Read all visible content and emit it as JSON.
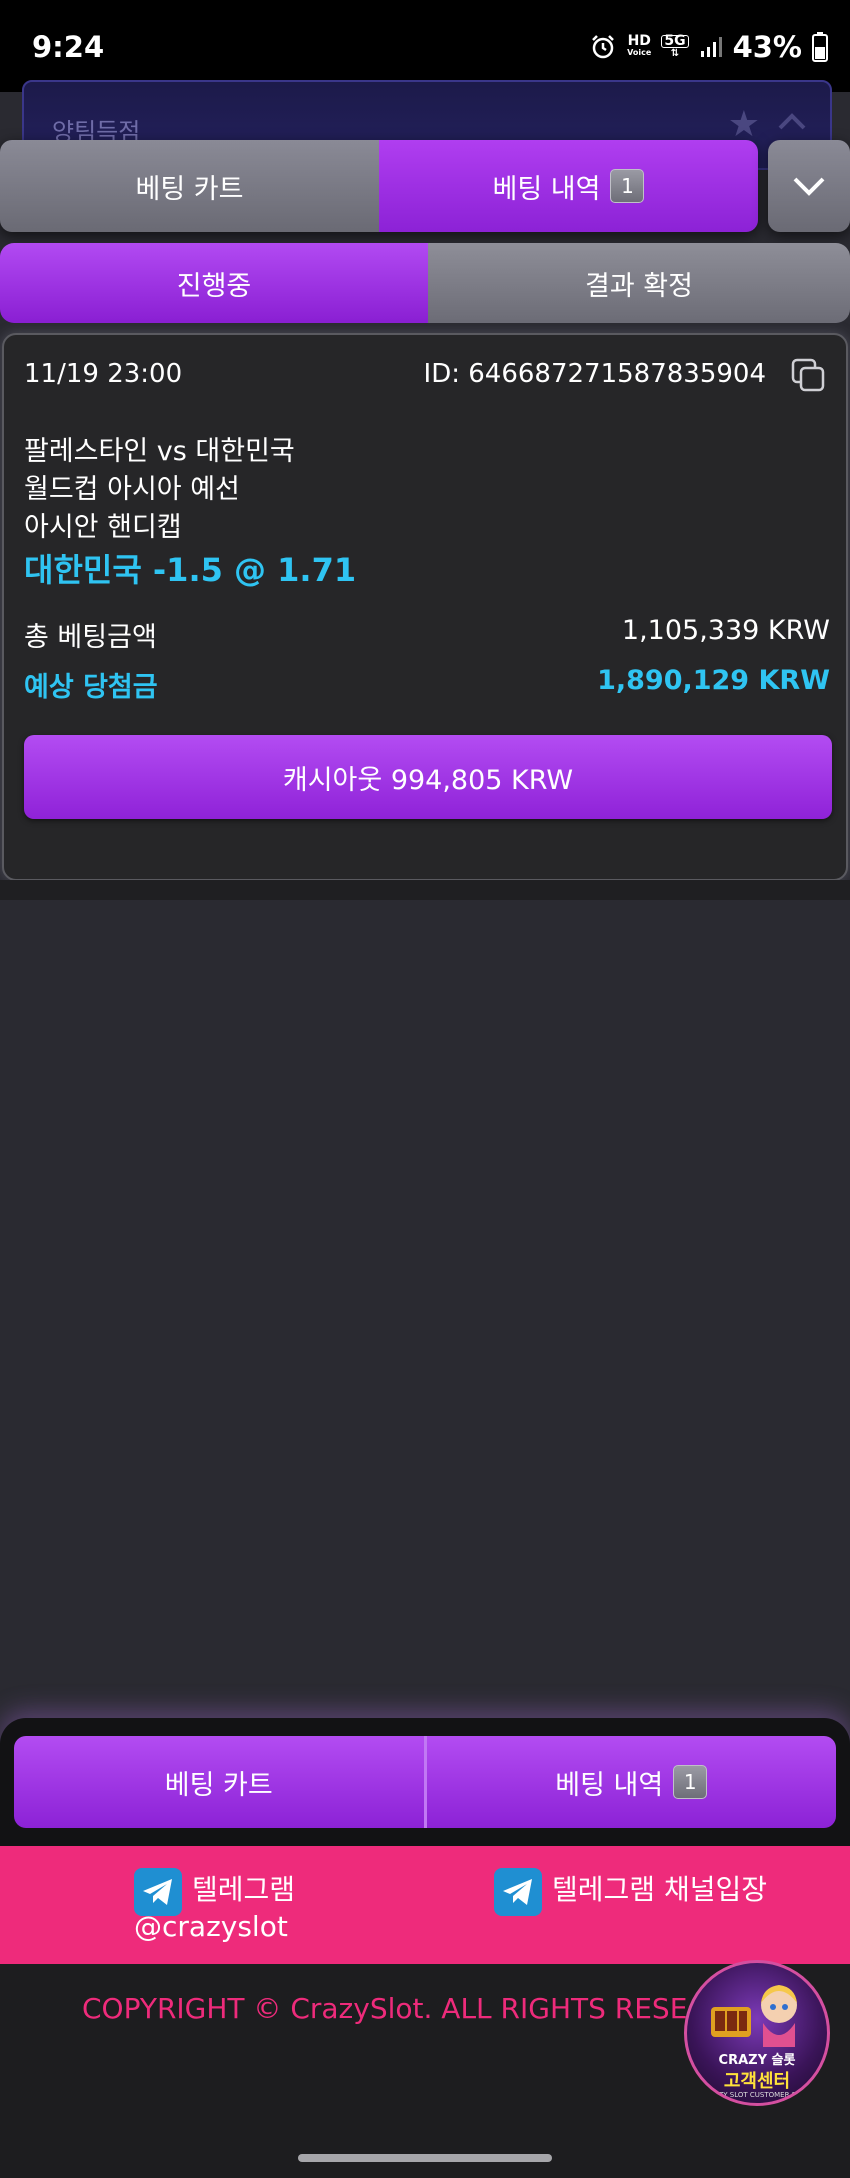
{
  "status_bar": {
    "time": "9:24",
    "network_hd": "HD",
    "network_voice": "Voice",
    "network_5g": "5G",
    "battery": "43%",
    "icons": [
      "alarm-icon",
      "hd-voice-icon",
      "5g-icon",
      "signal-icon",
      "battery-icon"
    ]
  },
  "background_header": {
    "title": "양팀득점"
  },
  "top_tabs": {
    "cart_label": "베팅 카트",
    "history_label": "베팅 내역",
    "history_badge": "1"
  },
  "sub_tabs": {
    "in_progress": "진행중",
    "settled": "결과 확정"
  },
  "bet": {
    "date": "11/19 23:00",
    "id": "ID: 646687271587835904",
    "match": "팔레스타인 vs 대한민국",
    "league": "월드컵 아시아 예선",
    "market": "아시안 핸디캡",
    "pick": "대한민국 -1.5 @ 1.71",
    "stake_label": "총 베팅금액",
    "stake_value": "1,105,339 KRW",
    "payout_label": "예상 당첨금",
    "payout_value": "1,890,129 KRW",
    "cashout_label": "캐시아웃 994,805 KRW"
  },
  "bottom_tabs": {
    "cart_label": "베팅 카트",
    "history_label": "베팅 내역",
    "history_badge": "1"
  },
  "telegram": {
    "link1_label": "텔레그램",
    "link1_handle": "@crazyslot",
    "link2_label": "텔레그램 채널입장"
  },
  "footer": {
    "copyright": "COPYRIGHT © CrazySlot. ALL RIGHTS RESE",
    "support_brand": "CRAZY 슬롯",
    "support_label": "고객센터",
    "support_sub": "CRAZY SLOT CUSTOMER SERV"
  },
  "colors": {
    "accent_purple": "#9a2ee0",
    "highlight_cyan": "#2fc4f2",
    "telegram_pink": "#ee2b7b"
  }
}
